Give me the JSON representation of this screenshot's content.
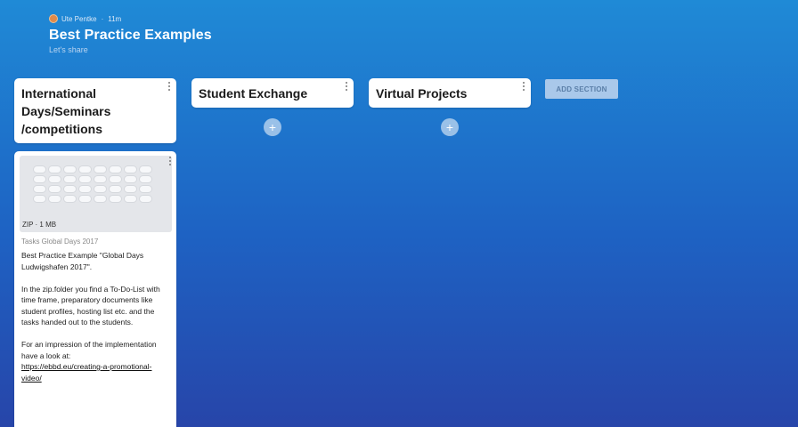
{
  "board": {
    "author": "Ute Pentke",
    "time": "11m",
    "title": "Best Practice Examples",
    "subtitle": "Let's share"
  },
  "columns": [
    {
      "title": "International Days/Seminars /competitions"
    },
    {
      "title": "Student Exchange",
      "add_label": "+"
    },
    {
      "title": "Virtual Projects",
      "add_label": "+"
    }
  ],
  "add_section_label": "ADD SECTION",
  "post": {
    "file_meta": "ZIP · 1 MB",
    "file_name": "Tasks Global Days 2017",
    "text": "Best Practice Example \"Global Days Ludwigshafen  2017\".\n\nIn the zip.folder you find a To-Do-List with time frame, preparatory documents like student profiles, hosting list etc. and the tasks handed out to the students.\n\nFor an impression of the implementation have a look at:",
    "link": "https://ebbd.eu/creating-a-promotional-video/"
  },
  "colors": {
    "gradient_top": "#1f8ad6",
    "gradient_bottom": "#2745a9",
    "card": "#ffffff",
    "add_section_bg": "#a9c8ea"
  },
  "icons": [
    "avatar",
    "kebab-menu-icon",
    "plus-icon",
    "zip-file-icon"
  ]
}
